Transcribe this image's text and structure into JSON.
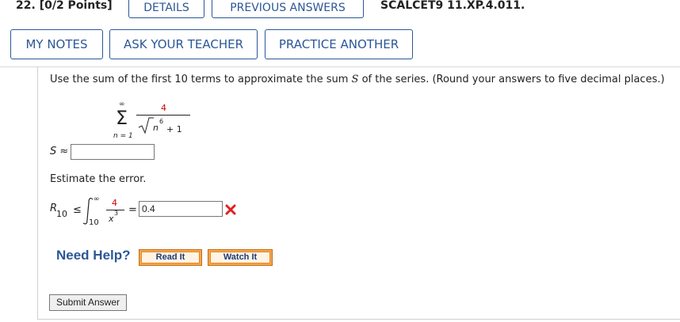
{
  "header": {
    "question_number": "22.",
    "points": "[0/2 Points]",
    "details_button": "DETAILS",
    "previous_answers_button": "PREVIOUS ANSWERS",
    "question_code": "SCALCET9 11.XP.4.011."
  },
  "nav": {
    "my_notes": "MY NOTES",
    "ask_teacher": "ASK YOUR TEACHER",
    "practice_another": "PRACTICE ANOTHER"
  },
  "question": {
    "instruction_a": "Use the sum of the first 10 terms to approximate the sum ",
    "instruction_var": "S",
    "instruction_b": " of the series. (Round your answers to five decimal places.)",
    "series": {
      "upper": "∞",
      "lower": "n = 1",
      "numerator": "4",
      "radicand": "n",
      "exponent": "6",
      "plus_one": "+ 1"
    },
    "sum_label": "S ≈",
    "sum_value": "",
    "estimate_label": "Estimate the error.",
    "error": {
      "lhs_R": "R",
      "lhs_sub": "10",
      "leq": "≤",
      "integral_upper": "∞",
      "integral_lower": "10",
      "numerator": "4",
      "denominator_var": "x",
      "denominator_exp": "3",
      "equals": "=",
      "value": "0.4",
      "status_icon": "incorrect-x-icon",
      "status_color": "#e02020"
    }
  },
  "help": {
    "need_help": "Need Help?",
    "read_it": "Read It",
    "watch_it": "Watch It"
  },
  "submit_label": "Submit Answer",
  "colors": {
    "accent": "#2b5797",
    "red": "#cc0000",
    "help_orange": "#f7a44b"
  }
}
